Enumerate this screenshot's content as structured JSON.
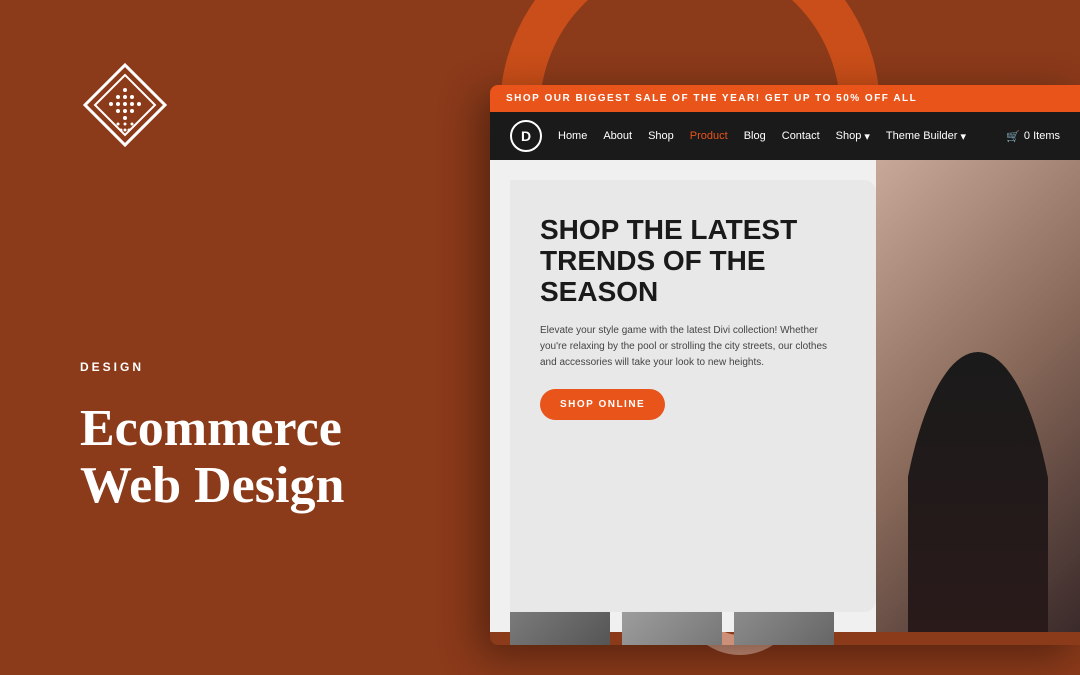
{
  "background_color": "#8B3A1A",
  "category": {
    "label": "DESIGN"
  },
  "heading": {
    "line1": "Ecommerce",
    "line2": "Web Design"
  },
  "announcement_bar": {
    "text": "SHOP OUR BIGGEST SALE OF THE YEAR! GET UP TO 50% OFF ALL"
  },
  "nav": {
    "logo_letter": "D",
    "links": [
      {
        "label": "Home",
        "active": false
      },
      {
        "label": "About",
        "active": false
      },
      {
        "label": "Shop",
        "active": false
      },
      {
        "label": "Product",
        "active": false
      },
      {
        "label": "Blog",
        "active": false
      },
      {
        "label": "Contact",
        "active": false
      },
      {
        "label": "Shop",
        "active": false,
        "dropdown": true
      },
      {
        "label": "Theme Builder",
        "active": false,
        "dropdown": true
      }
    ],
    "cart_label": "0 Items"
  },
  "hero": {
    "title_line1": "SHOP THE LATEST",
    "title_line2": "TRENDS OF THE",
    "title_line3": "SEASON",
    "description": "Elevate your style game with the latest Divi collection! Whether you're relaxing by the pool or strolling the city streets, our clothes and accessories will take your look to new heights.",
    "cta_button": "SHOP ONLINE"
  },
  "logo": {
    "alt": "Divi diamond logo"
  }
}
